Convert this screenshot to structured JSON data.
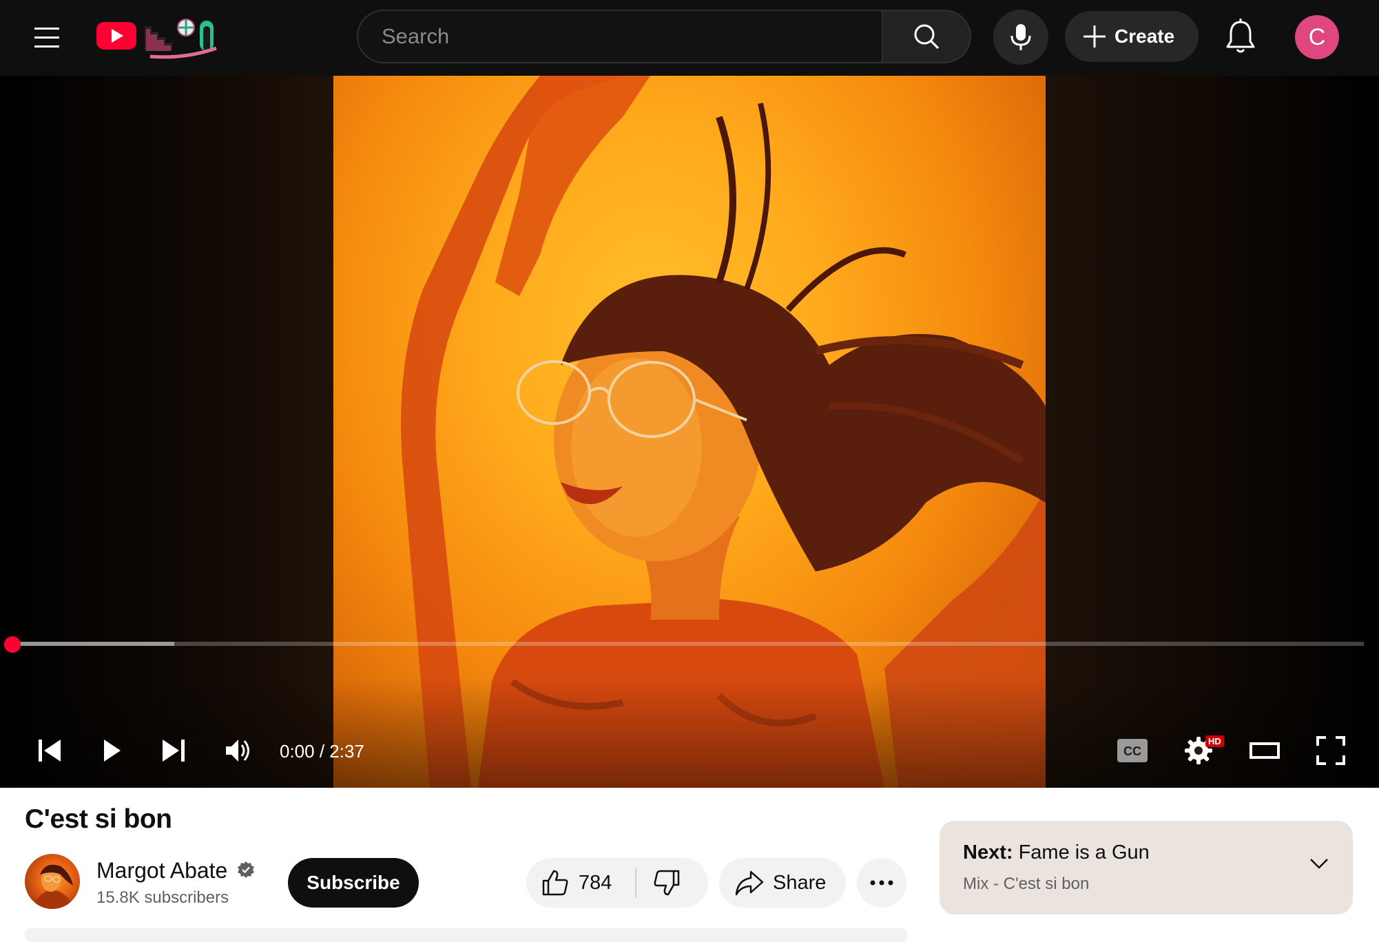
{
  "header": {
    "menu_icon": "hamburger-menu-icon",
    "logo_icon": "youtube-logo-icon",
    "search_placeholder": "Search",
    "search_icon": "search-icon",
    "mic_icon": "microphone-icon",
    "create_label": "Create",
    "notifications_icon": "bell-icon",
    "avatar_letter": "C",
    "avatar_color": "#e0467f"
  },
  "player": {
    "current_time": "0:00",
    "separator": " / ",
    "duration": "2:37",
    "progress_played": 0.0,
    "progress_buffered": 0.12,
    "hd_badge": "HD",
    "accent_color": "#ff0033",
    "controls": [
      "previous-icon",
      "play-icon",
      "next-icon",
      "volume-icon",
      "captions-icon",
      "settings-icon",
      "theater-mode-icon",
      "fullscreen-icon"
    ]
  },
  "video": {
    "title": "C'est si bon",
    "channel_name": "Margot Abate",
    "subscribers": "15.8K subscribers",
    "subscribe_label": "Subscribe",
    "like_count": "784",
    "share_label": "Share"
  },
  "up_next": {
    "prefix": "Next:",
    "title": "Fame is a Gun",
    "subtitle": "Mix - C'est si bon",
    "card_color": "#ebe3de"
  }
}
